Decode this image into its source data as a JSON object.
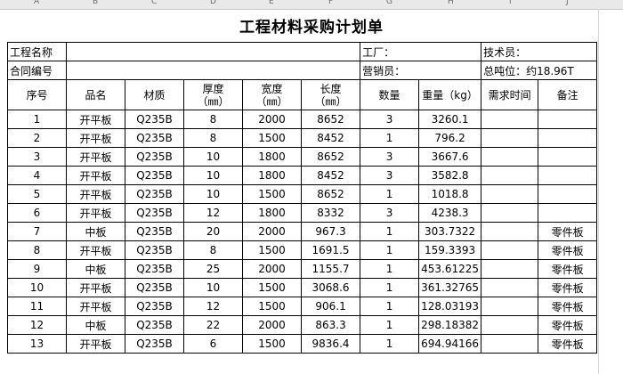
{
  "columns": [
    "A",
    "B",
    "C",
    "D",
    "E",
    "F",
    "G",
    "H",
    "I",
    "J"
  ],
  "title": "工程材料采购计划单",
  "info": {
    "project_name_label": "工程名称",
    "factory_label": "工厂：",
    "tech_label": "技术员：",
    "contract_label": "合同编号",
    "sales_label": "营销员：",
    "total_tonnage": "总吨位：约18.96T"
  },
  "headers": {
    "seq": "序号",
    "product": "品名",
    "material": "材质",
    "thickness": "厚度",
    "thickness_unit": "（㎜）",
    "width": "宽度",
    "width_unit": "（㎜）",
    "length": "长度",
    "length_unit": "（㎜）",
    "qty": "数量",
    "weight": "重量（kg）",
    "req_time": "需求时间",
    "remark": "备注"
  },
  "rows": [
    {
      "seq": "1",
      "product": "开平板",
      "material": "Q235B",
      "thickness": "8",
      "width": "2000",
      "length": "8652",
      "qty": "3",
      "weight": "3260.1",
      "req_time": "",
      "remark": ""
    },
    {
      "seq": "2",
      "product": "开平板",
      "material": "Q235B",
      "thickness": "8",
      "width": "1500",
      "length": "8452",
      "qty": "1",
      "weight": "796.2",
      "req_time": "",
      "remark": ""
    },
    {
      "seq": "3",
      "product": "开平板",
      "material": "Q235B",
      "thickness": "10",
      "width": "1800",
      "length": "8652",
      "qty": "3",
      "weight": "3667.6",
      "req_time": "",
      "remark": ""
    },
    {
      "seq": "4",
      "product": "开平板",
      "material": "Q235B",
      "thickness": "10",
      "width": "1800",
      "length": "8452",
      "qty": "3",
      "weight": "3582.8",
      "req_time": "",
      "remark": ""
    },
    {
      "seq": "5",
      "product": "开平板",
      "material": "Q235B",
      "thickness": "10",
      "width": "1500",
      "length": "8652",
      "qty": "1",
      "weight": "1018.8",
      "req_time": "",
      "remark": ""
    },
    {
      "seq": "6",
      "product": "开平板",
      "material": "Q235B",
      "thickness": "12",
      "width": "1800",
      "length": "8332",
      "qty": "3",
      "weight": "4238.3",
      "req_time": "",
      "remark": ""
    },
    {
      "seq": "7",
      "product": "中板",
      "material": "Q235B",
      "thickness": "20",
      "width": "2000",
      "length": "967.3",
      "qty": "1",
      "weight": "303.7322",
      "req_time": "",
      "remark": "零件板"
    },
    {
      "seq": "8",
      "product": "开平板",
      "material": "Q235B",
      "thickness": "8",
      "width": "1500",
      "length": "1691.5",
      "qty": "1",
      "weight": "159.3393",
      "req_time": "",
      "remark": "零件板"
    },
    {
      "seq": "9",
      "product": "中板",
      "material": "Q235B",
      "thickness": "25",
      "width": "2000",
      "length": "1155.7",
      "qty": "1",
      "weight": "453.61225",
      "req_time": "",
      "remark": "零件板"
    },
    {
      "seq": "10",
      "product": "开平板",
      "material": "Q235B",
      "thickness": "10",
      "width": "1500",
      "length": "3068.6",
      "qty": "1",
      "weight": "361.32765",
      "req_time": "",
      "remark": "零件板"
    },
    {
      "seq": "11",
      "product": "开平板",
      "material": "Q235B",
      "thickness": "12",
      "width": "1500",
      "length": "906.1",
      "qty": "1",
      "weight": "128.03193",
      "req_time": "",
      "remark": "零件板"
    },
    {
      "seq": "12",
      "product": "中板",
      "material": "Q235B",
      "thickness": "22",
      "width": "2000",
      "length": "863.3",
      "qty": "1",
      "weight": "298.18382",
      "req_time": "",
      "remark": "零件板"
    },
    {
      "seq": "13",
      "product": "开平板",
      "material": "Q235B",
      "thickness": "6",
      "width": "1500",
      "length": "9836.4",
      "qty": "1",
      "weight": "694.94166",
      "req_time": "",
      "remark": "零件板"
    }
  ]
}
